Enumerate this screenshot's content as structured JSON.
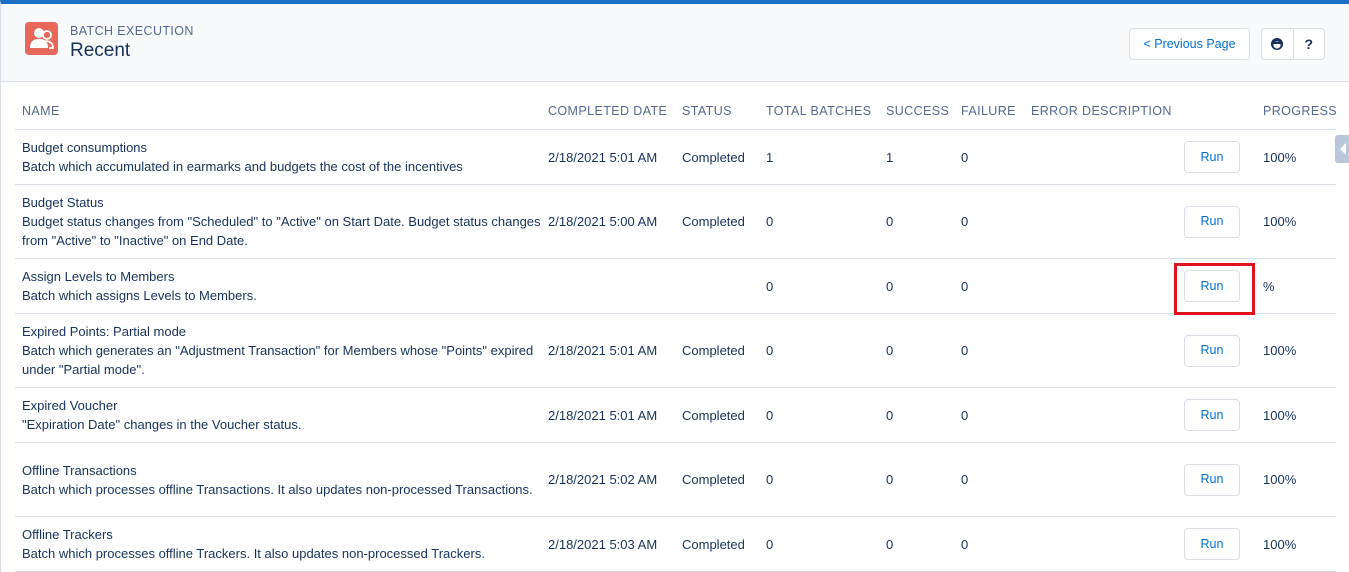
{
  "header": {
    "app_label": "BATCH EXECUTION",
    "title": "Recent",
    "previous_page_label": "< Previous Page",
    "help_label": "?"
  },
  "columns": [
    "NAME",
    "COMPLETED DATE",
    "STATUS",
    "TOTAL BATCHES",
    "SUCCESS",
    "FAILURE",
    "ERROR DESCRIPTION",
    "",
    "PROGRESS"
  ],
  "rows": [
    {
      "title": "Budget consumptions",
      "description": "Batch which accumulated in earmarks and budgets the cost of the incentives",
      "completed_date": "2/18/2021 5:01 AM",
      "status": "Completed",
      "total_batches": "1",
      "success": "1",
      "failure": "0",
      "error_description": "",
      "run_label": "Run",
      "progress": "100%"
    },
    {
      "title": "Budget Status",
      "description": "Budget status changes from \"Scheduled\" to \"Active\" on Start Date. Budget status changes from \"Active\" to \"Inactive\" on End Date.",
      "completed_date": "2/18/2021 5:00 AM",
      "status": "Completed",
      "total_batches": "0",
      "success": "0",
      "failure": "0",
      "error_description": "",
      "run_label": "Run",
      "progress": "100%"
    },
    {
      "title": "Assign Levels to Members",
      "description": "Batch which assigns Levels to Members.",
      "completed_date": "",
      "status": "",
      "total_batches": "0",
      "success": "0",
      "failure": "0",
      "error_description": "",
      "run_label": "Run",
      "progress": "%"
    },
    {
      "title": "Expired Points: Partial mode",
      "description": "Batch which generates an \"Adjustment Transaction\" for Members whose \"Points\" expired under \"Partial mode\".",
      "completed_date": "2/18/2021 5:01 AM",
      "status": "Completed",
      "total_batches": "0",
      "success": "0",
      "failure": "0",
      "error_description": "",
      "run_label": "Run",
      "progress": "100%"
    },
    {
      "title": "Expired Voucher",
      "description": "\"Expiration Date\" changes in the Voucher status.",
      "completed_date": "2/18/2021 5:01 AM",
      "status": "Completed",
      "total_batches": "0",
      "success": "0",
      "failure": "0",
      "error_description": "",
      "run_label": "Run",
      "progress": "100%"
    },
    {
      "title": "Offline Transactions",
      "description": "Batch which processes offline Transactions. It also updates non-processed Transactions.",
      "completed_date": "2/18/2021 5:02 AM",
      "status": "Completed",
      "total_batches": "0",
      "success": "0",
      "failure": "0",
      "error_description": "",
      "run_label": "Run",
      "progress": "100%"
    },
    {
      "title": "Offline Trackers",
      "description": "Batch which processes offline Trackers. It also updates non-processed Trackers.",
      "completed_date": "2/18/2021 5:03 AM",
      "status": "Completed",
      "total_batches": "0",
      "success": "0",
      "failure": "0",
      "error_description": "",
      "run_label": "Run",
      "progress": "100%"
    }
  ],
  "colors": {
    "accent": "#1b6fc7",
    "link": "#0070d2",
    "app_icon": "#e8675b",
    "highlight": "#e0141e"
  },
  "icons": {
    "app": "users-icon",
    "chat": "agent-icon",
    "help": "help-icon",
    "side_tab": "chevron-left-icon"
  }
}
